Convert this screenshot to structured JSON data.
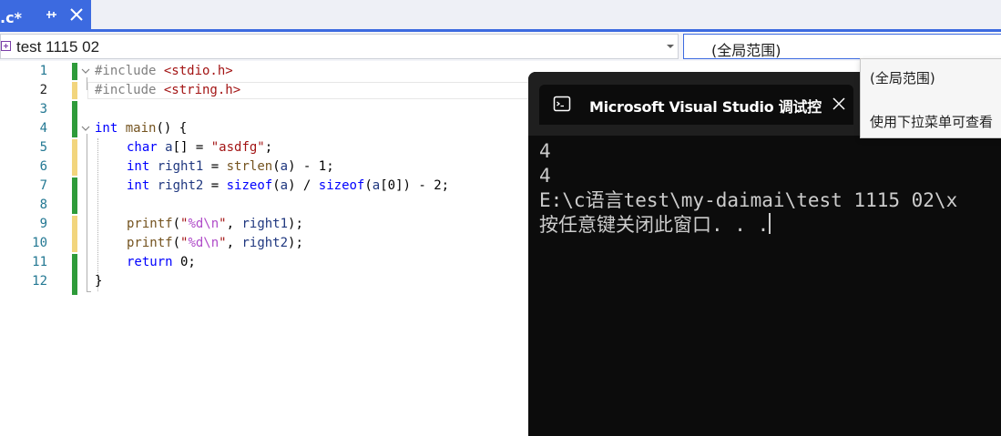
{
  "tab": {
    "title": "源.c*",
    "pin_icon": "pin-icon",
    "close_icon": "close-icon"
  },
  "navbar": {
    "project": "test 1115 02",
    "scope": "(全局范围)"
  },
  "line_numbers": [
    "1",
    "2",
    "3",
    "4",
    "5",
    "6",
    "7",
    "8",
    "9",
    "10",
    "11",
    "12"
  ],
  "code": {
    "l1": {
      "directive": "#include ",
      "header": "<stdio.h>"
    },
    "l2": {
      "directive": "#include ",
      "header": "<string.h>"
    },
    "l4": {
      "kw": "int",
      "name": " main",
      "rest": "() {"
    },
    "l5": {
      "kw": "char",
      "var": " a",
      "mid": "[] = ",
      "str": "\"asdfg\"",
      "end": ";"
    },
    "l6": {
      "kw": "int",
      "var": " right1",
      "mid": " = ",
      "fn": "strlen",
      "open": "(",
      "arg": "a",
      "end": ") - 1;"
    },
    "l7": {
      "kw": "int",
      "var": " right2",
      "mid": " = ",
      "kw2": "sizeof",
      "open": "(",
      "arg": "a",
      "div": ") / ",
      "kw3": "sizeof",
      "open2": "(",
      "arg2": "a",
      "end": "[0]) - 2;"
    },
    "l9": {
      "fn": "printf",
      "open": "(",
      "q1": "\"",
      "fmt": "%d\\n",
      "q2": "\"",
      "comma": ", ",
      "var": "right1",
      "end": ");"
    },
    "l10": {
      "fn": "printf",
      "open": "(",
      "q1": "\"",
      "fmt": "%d\\n",
      "q2": "\"",
      "comma": ", ",
      "var": "right2",
      "end": ");"
    },
    "l11": {
      "kw": "return",
      "end": " 0;"
    },
    "l12": {
      "brace": "}"
    }
  },
  "console": {
    "title": "Microsoft Visual Studio 调试控",
    "icon": "console-app-icon",
    "close_icon": "close-icon",
    "lines": [
      "4",
      "4",
      "",
      "E:\\c语言test\\my-daimai\\test 1115 02\\x",
      "按任意键关闭此窗口. . ."
    ]
  },
  "scope_popup": {
    "items": [
      "(全局范围)",
      "使用下拉菜单可查看"
    ]
  },
  "colors": {
    "accent": "#3c6ae0",
    "console_bg": "#0c0c0c",
    "keyword": "#0000ff",
    "string": "#a31515"
  }
}
